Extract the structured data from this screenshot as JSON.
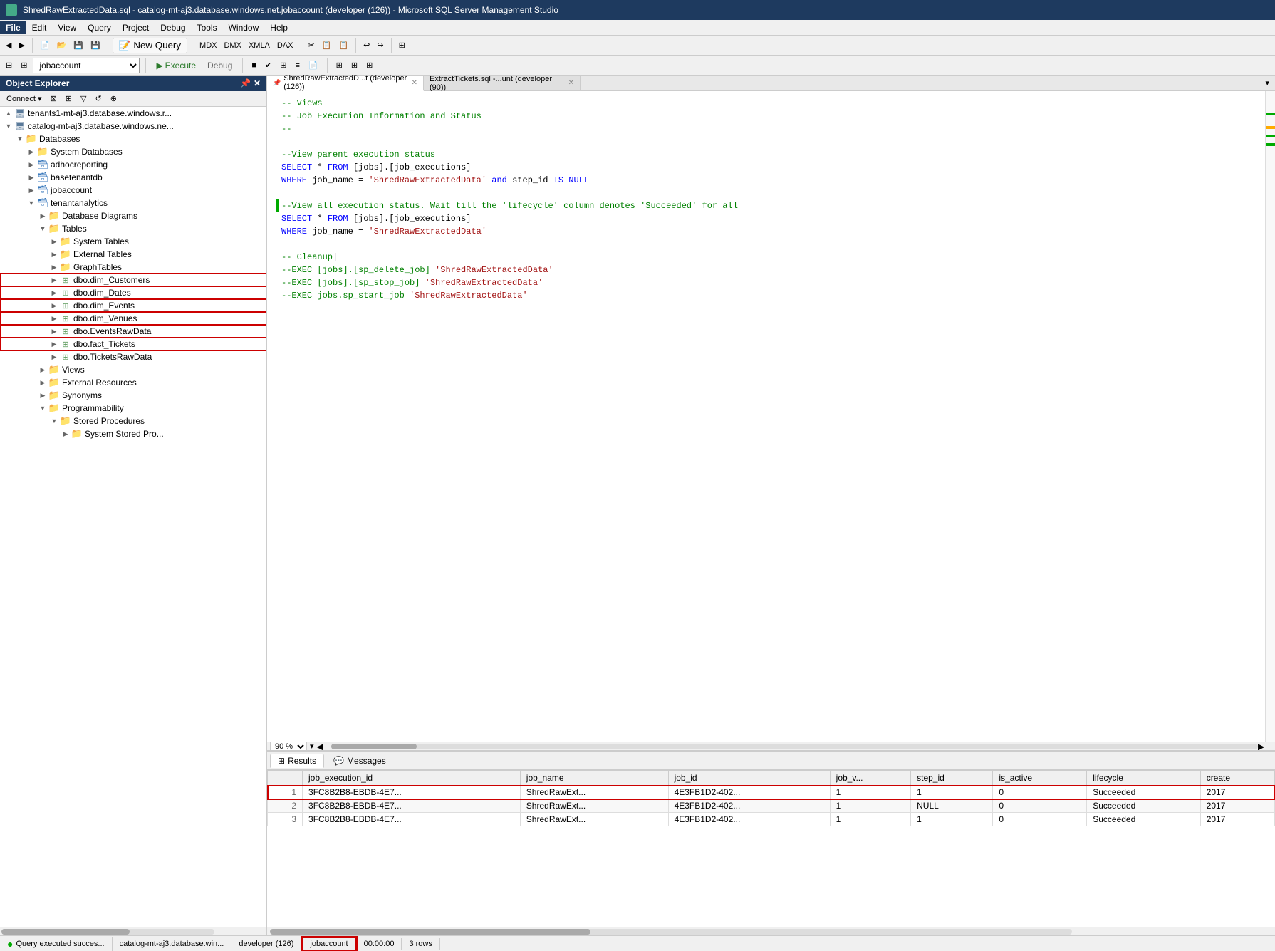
{
  "title_bar": {
    "title": "ShredRawExtractedData.sql - catalog-mt-aj3.database.windows.net.jobaccount (developer (126)) - Microsoft SQL Server Management Studio"
  },
  "menu": {
    "items": [
      "File",
      "Edit",
      "View",
      "Query",
      "Project",
      "Debug",
      "Tools",
      "Window",
      "Help"
    ]
  },
  "toolbar1": {
    "new_query_label": "New Query"
  },
  "toolbar2": {
    "database": "jobaccount",
    "execute_label": "Execute",
    "debug_label": "Debug"
  },
  "object_explorer": {
    "title": "Object Explorer",
    "connect_label": "Connect",
    "tree": [
      {
        "id": "server1",
        "label": "tenants1-mt-aj3.database.windows.r...",
        "level": 0,
        "type": "server",
        "expanded": true
      },
      {
        "id": "server2",
        "label": "catalog-mt-aj3.database.windows.ne...",
        "level": 0,
        "type": "server",
        "expanded": true
      },
      {
        "id": "databases",
        "label": "Databases",
        "level": 1,
        "type": "folder",
        "expanded": true
      },
      {
        "id": "sysdbs",
        "label": "System Databases",
        "level": 2,
        "type": "folder",
        "expanded": false
      },
      {
        "id": "adhoc",
        "label": "adhocreporting",
        "level": 2,
        "type": "db",
        "expanded": false
      },
      {
        "id": "base",
        "label": "basetenantdb",
        "level": 2,
        "type": "db",
        "expanded": false
      },
      {
        "id": "jobaccount",
        "label": "jobaccount",
        "level": 2,
        "type": "db",
        "expanded": false
      },
      {
        "id": "tenantanalytics",
        "label": "tenantanalytics",
        "level": 2,
        "type": "db",
        "expanded": true
      },
      {
        "id": "dbdiagrams",
        "label": "Database Diagrams",
        "level": 3,
        "type": "folder",
        "expanded": false
      },
      {
        "id": "tables",
        "label": "Tables",
        "level": 3,
        "type": "folder",
        "expanded": true
      },
      {
        "id": "systables",
        "label": "System Tables",
        "level": 4,
        "type": "folder",
        "expanded": false
      },
      {
        "id": "exttables",
        "label": "External Tables",
        "level": 4,
        "type": "folder",
        "expanded": false
      },
      {
        "id": "graphtables",
        "label": "GraphTables",
        "level": 4,
        "type": "folder",
        "expanded": false
      },
      {
        "id": "dimcust",
        "label": "dbo.dim_Customers",
        "level": 4,
        "type": "table",
        "expanded": false,
        "highlighted": true
      },
      {
        "id": "dimdates",
        "label": "dbo.dim_Dates",
        "level": 4,
        "type": "table",
        "expanded": false,
        "highlighted": true
      },
      {
        "id": "dimevents",
        "label": "dbo.dim_Events",
        "level": 4,
        "type": "table",
        "expanded": false,
        "highlighted": true
      },
      {
        "id": "dimvenues",
        "label": "dbo.dim_Venues",
        "level": 4,
        "type": "table",
        "expanded": false,
        "highlighted": true
      },
      {
        "id": "eventsraw",
        "label": "dbo.EventsRawData",
        "level": 4,
        "type": "table",
        "expanded": false,
        "highlighted": true
      },
      {
        "id": "facttickets",
        "label": "dbo.fact_Tickets",
        "level": 4,
        "type": "table",
        "expanded": false,
        "highlighted": true
      },
      {
        "id": "ticketsraw",
        "label": "dbo.TicketsRawData",
        "level": 4,
        "type": "table",
        "expanded": false
      },
      {
        "id": "views",
        "label": "Views",
        "level": 3,
        "type": "folder",
        "expanded": false
      },
      {
        "id": "extresources",
        "label": "External Resources",
        "level": 3,
        "type": "folder",
        "expanded": false
      },
      {
        "id": "synonyms",
        "label": "Synonyms",
        "level": 3,
        "type": "folder",
        "expanded": false
      },
      {
        "id": "programmability",
        "label": "Programmability",
        "level": 3,
        "type": "folder",
        "expanded": true
      },
      {
        "id": "storedprocs",
        "label": "Stored Procedures",
        "level": 4,
        "type": "folder",
        "expanded": true
      },
      {
        "id": "sysstoredprocs",
        "label": "System Stored Pro...",
        "level": 5,
        "type": "folder",
        "expanded": false
      }
    ]
  },
  "editor": {
    "tabs": [
      {
        "id": "tab1",
        "label": "ShredRawExtractedD...t (developer (126))",
        "active": true,
        "pinned": true
      },
      {
        "id": "tab2",
        "label": "ExtractTickets.sql -...unt (developer (90))",
        "active": false
      }
    ],
    "code_lines": [
      {
        "indent": "",
        "text": "-- Views",
        "type": "comment"
      },
      {
        "indent": "",
        "text": "-- Job Execution Information and Status",
        "type": "comment"
      },
      {
        "indent": "",
        "text": "--",
        "type": "comment"
      },
      {
        "indent": "",
        "text": "",
        "type": "plain"
      },
      {
        "indent": "",
        "text": "--View parent execution status",
        "type": "comment"
      },
      {
        "indent": "",
        "text": "SELECT * FROM [jobs].[job_executions]",
        "type": "code",
        "indicator": false
      },
      {
        "indent": "",
        "text": "WHERE job_name = 'ShredRawExtractedData' and step_id IS NULL",
        "type": "code"
      },
      {
        "indent": "",
        "text": "",
        "type": "plain"
      },
      {
        "indent": "",
        "text": "--View all execution status. Wait till the 'lifecycle' column denotes 'Succeeded' for al",
        "type": "comment",
        "indicator": true
      },
      {
        "indent": "",
        "text": "SELECT * FROM [jobs].[job_executions]",
        "type": "code"
      },
      {
        "indent": "",
        "text": "WHERE job_name = 'ShredRawExtractedData'",
        "type": "code"
      },
      {
        "indent": "",
        "text": "",
        "type": "plain"
      },
      {
        "indent": "",
        "text": "-- Cleanup",
        "type": "comment"
      },
      {
        "indent": "",
        "text": "--EXEC [jobs].[sp_delete_job] 'ShredRawExtractedData'",
        "type": "comment"
      },
      {
        "indent": "",
        "text": "--EXEC [jobs].[sp_stop_job] 'ShredRawExtractedData'",
        "type": "comment"
      },
      {
        "indent": "",
        "text": "--EXEC jobs.sp_start_job 'ShredRawExtractedData'",
        "type": "comment"
      }
    ],
    "zoom": "90 %"
  },
  "results": {
    "tabs": [
      {
        "label": "Results",
        "icon": "grid",
        "active": true
      },
      {
        "label": "Messages",
        "icon": "message",
        "active": false
      }
    ],
    "columns": [
      "",
      "job_execution_id",
      "job_name",
      "job_id",
      "job_v...",
      "step_id",
      "is_active",
      "lifecycle",
      "create"
    ],
    "rows": [
      {
        "num": "1",
        "job_execution_id": "3FC8B2B8-EBDB-4E7...",
        "job_name": "ShredRawExt...",
        "job_id": "4E3FB1D2-402...",
        "job_v": "1",
        "step_id": "1",
        "is_active": "0",
        "lifecycle": "Succeeded",
        "created": "2017"
      },
      {
        "num": "2",
        "job_execution_id": "3FC8B2B8-EBDB-4E7...",
        "job_name": "ShredRawExt...",
        "job_id": "4E3FB1D2-402...",
        "job_v": "1",
        "step_id": "NULL",
        "is_active": "0",
        "lifecycle": "Succeeded",
        "created": "2017"
      },
      {
        "num": "3",
        "job_execution_id": "3FC8B2B8-EBDB-4E7...",
        "job_name": "ShredRawExt...",
        "job_id": "4E3FB1D2-402...",
        "job_v": "1",
        "step_id": "1",
        "is_active": "0",
        "lifecycle": "Succeeded",
        "created": "2017"
      }
    ]
  },
  "status_bar": {
    "message": "Query executed succes...",
    "server": "catalog-mt-aj3.database.win...",
    "user": "developer (126)",
    "database": "jobaccount",
    "time": "00:00:00",
    "rows": "3 rows"
  },
  "colors": {
    "title_bg": "#1e3a5f",
    "active_tab_bg": "#ffffff",
    "inactive_tab_bg": "#e0e0e0",
    "highlight_border": "#cc0000",
    "success_green": "#00aa00"
  }
}
